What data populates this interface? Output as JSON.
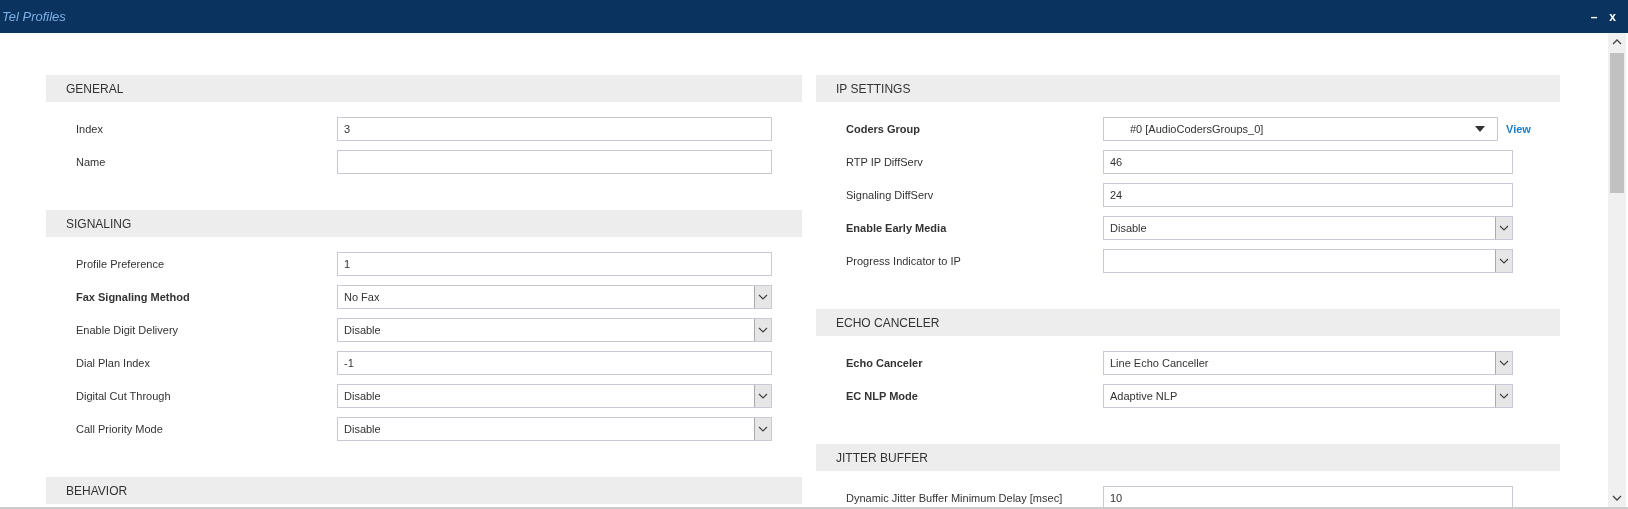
{
  "window": {
    "title": "Tel Profiles",
    "controls": [
      "–",
      "x"
    ]
  },
  "columns": [
    {
      "sections": [
        {
          "title": "GENERAL",
          "fields": [
            {
              "label": "Index",
              "bold": false,
              "kind": "text",
              "value": "3"
            },
            {
              "label": "Name",
              "bold": false,
              "kind": "text"
            }
          ]
        },
        {
          "title": "SIGNALING",
          "fields": [
            {
              "label": "Profile Preference",
              "bold": false,
              "kind": "text",
              "value": "1"
            },
            {
              "label": "Fax Signaling Method",
              "bold": true,
              "kind": "select",
              "value": "No Fax"
            },
            {
              "label": "Enable Digit Delivery",
              "bold": false,
              "kind": "select",
              "value": "Disable"
            },
            {
              "label": "Dial Plan Index",
              "bold": false,
              "kind": "text",
              "value": "-1"
            },
            {
              "label": "Digital Cut Through",
              "bold": false,
              "kind": "select",
              "value": "Disable"
            },
            {
              "label": "Call Priority Mode",
              "bold": false,
              "kind": "select",
              "value": "Disable"
            }
          ]
        },
        {
          "title": "BEHAVIOR"
        }
      ]
    },
    {
      "sections": [
        {
          "title": "IP SETTINGS",
          "fields": [
            {
              "label": "Coders Group",
              "bold": true,
              "kind": "combo",
              "value": "#0 [AudioCodersGroups_0]",
              "link": "View"
            },
            {
              "label": "RTP IP DiffServ",
              "bold": false,
              "kind": "text",
              "value": "46"
            },
            {
              "label": "Signaling DiffServ",
              "bold": false,
              "kind": "text",
              "value": "24"
            },
            {
              "label": "Enable Early Media",
              "bold": true,
              "kind": "select",
              "value": "Disable"
            },
            {
              "label": "Progress Indicator to IP",
              "bold": false,
              "kind": "select"
            }
          ]
        },
        {
          "title": "ECHO CANCELER",
          "fields": [
            {
              "label": "Echo Canceler",
              "bold": true,
              "kind": "select",
              "value": "Line Echo Canceller"
            },
            {
              "label": "EC NLP Mode",
              "bold": true,
              "kind": "select",
              "value": "Adaptive NLP"
            }
          ]
        },
        {
          "title": "JITTER BUFFER",
          "fields": [
            {
              "label": "Dynamic Jitter Buffer Minimum Delay [msec]",
              "bold": false,
              "kind": "text",
              "value": "10"
            }
          ]
        }
      ]
    }
  ]
}
